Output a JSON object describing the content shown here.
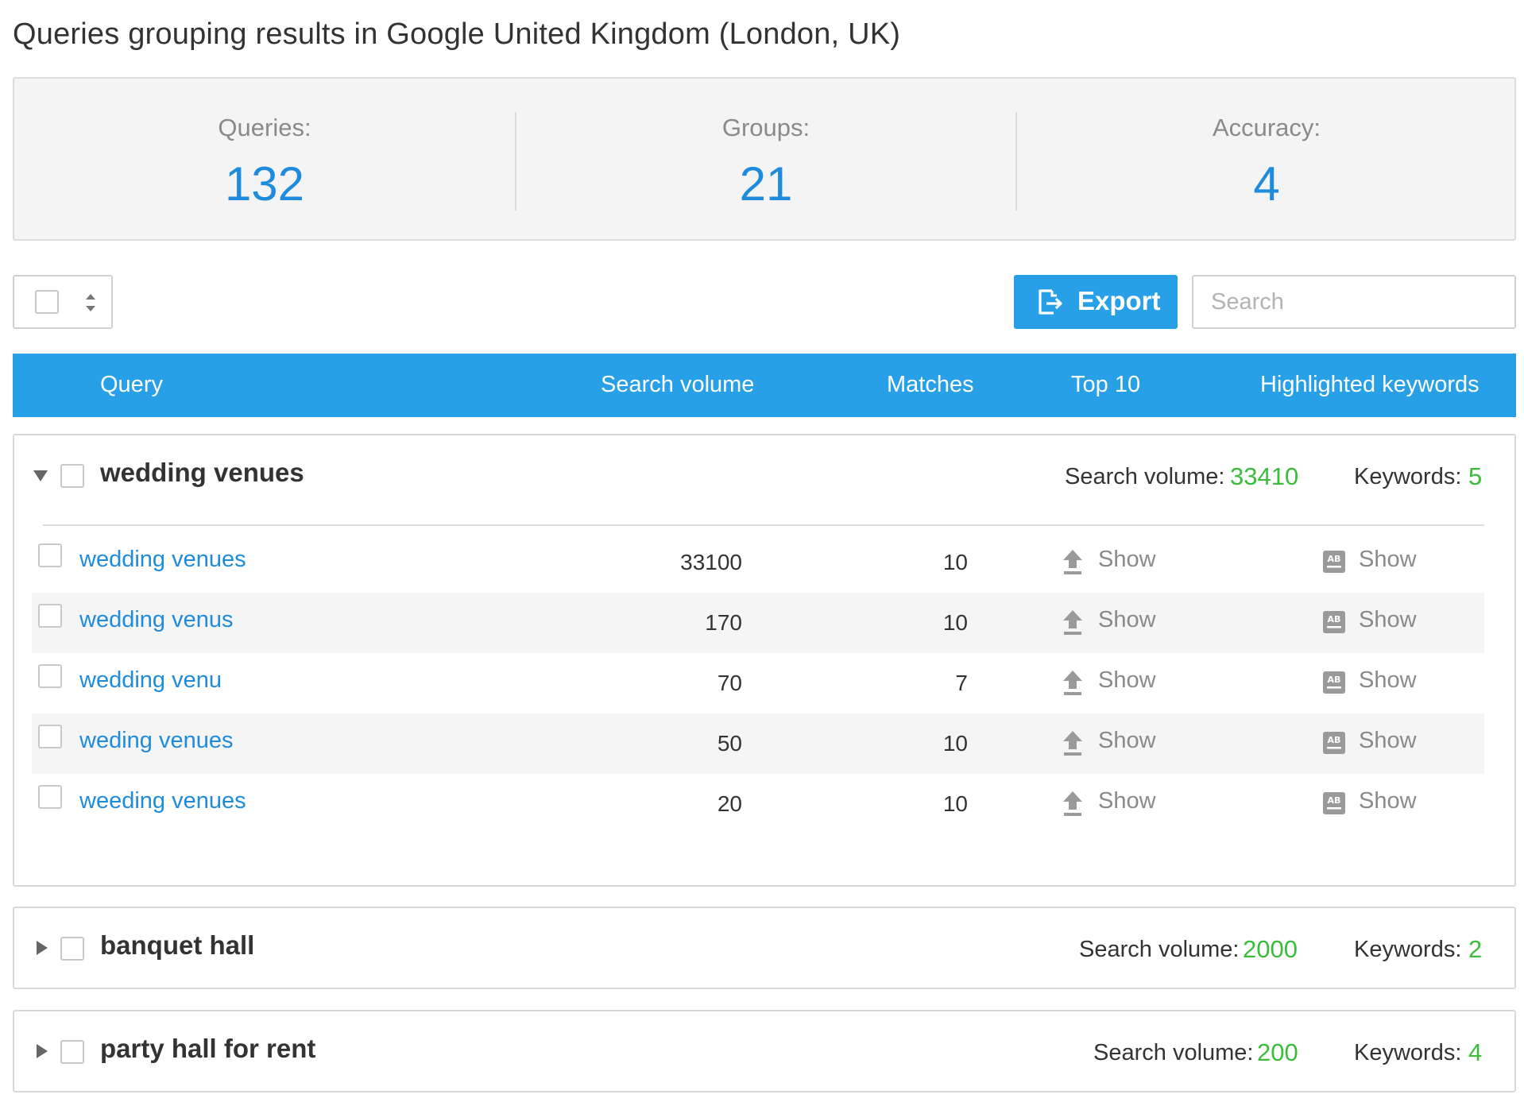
{
  "page": {
    "title": "Queries grouping results in Google United Kingdom (London, UK)"
  },
  "stats": {
    "queries_label": "Queries:",
    "queries_value": "132",
    "groups_label": "Groups:",
    "groups_value": "21",
    "accuracy_label": "Accuracy:",
    "accuracy_value": "4"
  },
  "toolbar": {
    "export_label": "Export",
    "search_placeholder": "Search"
  },
  "table": {
    "headers": {
      "query": "Query",
      "search_volume": "Search volume",
      "matches": "Matches",
      "top10": "Top 10",
      "highlighted": "Highlighted keywords"
    }
  },
  "groups": [
    {
      "name": "wedding venues",
      "expanded": true,
      "sv_label": "Search volume:",
      "sv_value": "33410",
      "kw_label": "Keywords:",
      "kw_value": "5",
      "rows": [
        {
          "query": "wedding venues",
          "volume": "33100",
          "matches": "10",
          "top10": "Show",
          "highlighted": "Show"
        },
        {
          "query": "wedding venus",
          "volume": "170",
          "matches": "10",
          "top10": "Show",
          "highlighted": "Show"
        },
        {
          "query": "wedding venu",
          "volume": "70",
          "matches": "7",
          "top10": "Show",
          "highlighted": "Show"
        },
        {
          "query": "weding venues",
          "volume": "50",
          "matches": "10",
          "top10": "Show",
          "highlighted": "Show"
        },
        {
          "query": "weeding venues",
          "volume": "20",
          "matches": "10",
          "top10": "Show",
          "highlighted": "Show"
        }
      ]
    },
    {
      "name": "banquet hall",
      "expanded": false,
      "sv_label": "Search volume:",
      "sv_value": "2000",
      "kw_label": "Keywords:",
      "kw_value": "2"
    },
    {
      "name": "party hall for rent",
      "expanded": false,
      "sv_label": "Search volume:",
      "sv_value": "200",
      "kw_label": "Keywords:",
      "kw_value": "4"
    }
  ],
  "icons": {
    "export": "export-icon",
    "top10": "upload-arrow-icon",
    "highlighted": "ab-text-icon",
    "expand": "caret-icon",
    "sort": "sort-arrows-icon"
  },
  "colors": {
    "accent": "#27a0e8",
    "link": "#1f8bdc",
    "positive": "#3bbd3b",
    "muted": "#8a8a8a"
  }
}
